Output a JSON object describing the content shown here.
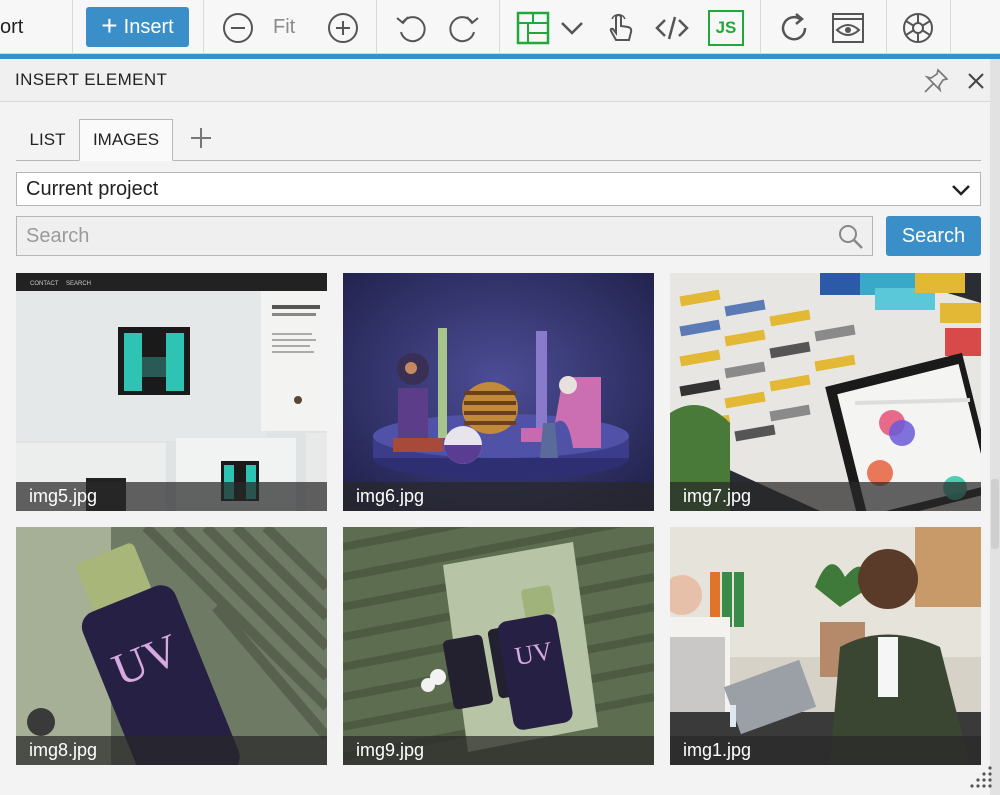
{
  "toolbar": {
    "partial_label": "ort",
    "insert_label": "Insert",
    "fit_label": "Fit",
    "js_label": "JS",
    "colors": {
      "accent": "#3b8fc8",
      "green": "#22a83a"
    }
  },
  "panel": {
    "title": "INSERT ELEMENT",
    "tabs": [
      {
        "label": "LIST"
      },
      {
        "label": "IMAGES"
      }
    ],
    "source_select": {
      "value": "Current project"
    },
    "search": {
      "placeholder": "Search",
      "button_label": "Search"
    },
    "images": [
      {
        "name": "img5.jpg"
      },
      {
        "name": "img6.jpg"
      },
      {
        "name": "img7.jpg"
      },
      {
        "name": "img8.jpg"
      },
      {
        "name": "img9.jpg"
      },
      {
        "name": "img1.jpg"
      }
    ],
    "thumb_nav": {
      "contact": "CONTACT",
      "search": "SEARCH"
    }
  }
}
